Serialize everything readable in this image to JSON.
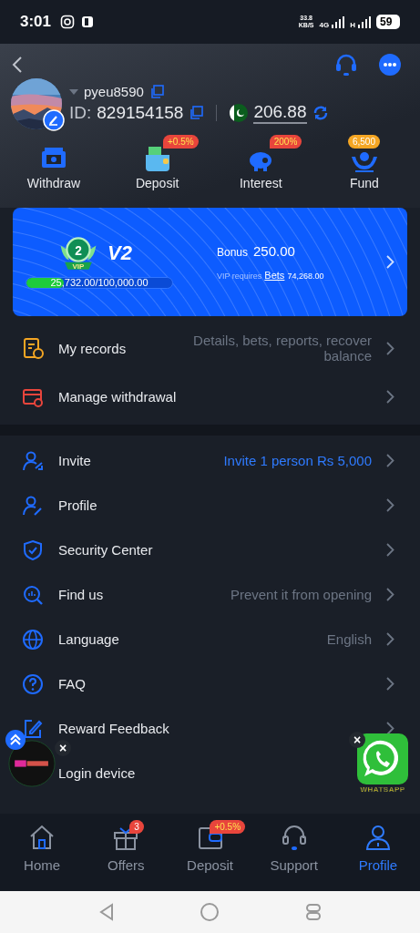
{
  "status_bar": {
    "time": "3:01",
    "speed": "33.8",
    "speed_unit": "KB/S",
    "network_1": "4G",
    "network_2": "H",
    "battery": "59"
  },
  "profile": {
    "username": "pyeu8590",
    "id_label": "ID:",
    "id": "829154158",
    "balance": "206.88"
  },
  "quick_actions": [
    {
      "kind": "withdraw",
      "label": "Withdraw"
    },
    {
      "kind": "deposit",
      "label": "Deposit",
      "badge": "+0.5%"
    },
    {
      "kind": "interest",
      "label": "Interest",
      "badge": "200%"
    },
    {
      "kind": "fund",
      "label": "Fund",
      "badge": "6,500"
    }
  ],
  "vip": {
    "badge_number": "2",
    "badge_text": "VIP",
    "level": "V2",
    "progress_text": "25,732.00/100,000.00",
    "progress": {
      "level": 0.2573
    },
    "bonus_label": "Bonus",
    "bonus": "250.00",
    "requires_label": "VIP requires",
    "requires_link": "Bets",
    "requires_amount": "74,268.00"
  },
  "records": [
    {
      "kind": "records",
      "label": "My records",
      "value": "Details, bets, reports, recover balance",
      "chevron": true
    },
    {
      "kind": "withdrawal",
      "label": "Manage withdrawal",
      "chevron": true
    }
  ],
  "menu": [
    {
      "kind": "invite",
      "label": "Invite",
      "value": "Invite 1 person Rs 5,000",
      "highlighted": true,
      "chevron": true
    },
    {
      "kind": "profile",
      "label": "Profile",
      "chevron": true
    },
    {
      "kind": "security",
      "label": "Security Center",
      "chevron": true
    },
    {
      "kind": "find",
      "label": "Find us",
      "value": "Prevent it from opening",
      "highlighted": false,
      "chevron": true
    },
    {
      "kind": "language",
      "label": "Language",
      "value": "English",
      "highlighted": false,
      "chevron": true
    },
    {
      "kind": "faq",
      "label": "FAQ",
      "chevron": true
    },
    {
      "kind": "feedback",
      "label": "Reward Feedback",
      "chevron": true
    },
    {
      "label": "Login device"
    }
  ],
  "floating": {
    "close_left": "×",
    "close_right": "×",
    "whatsapp_label": "WHATSAPP"
  },
  "bottom_nav": [
    {
      "kind": "home",
      "label": "Home",
      "selected": false
    },
    {
      "kind": "offers",
      "label": "Offers",
      "badge": "3",
      "selected": false
    },
    {
      "kind": "deposit",
      "label": "Deposit",
      "badge": "+0.5%",
      "selected": false
    },
    {
      "kind": "support",
      "label": "Support",
      "selected": false
    },
    {
      "kind": "profile",
      "label": "Profile",
      "selected": true
    }
  ]
}
